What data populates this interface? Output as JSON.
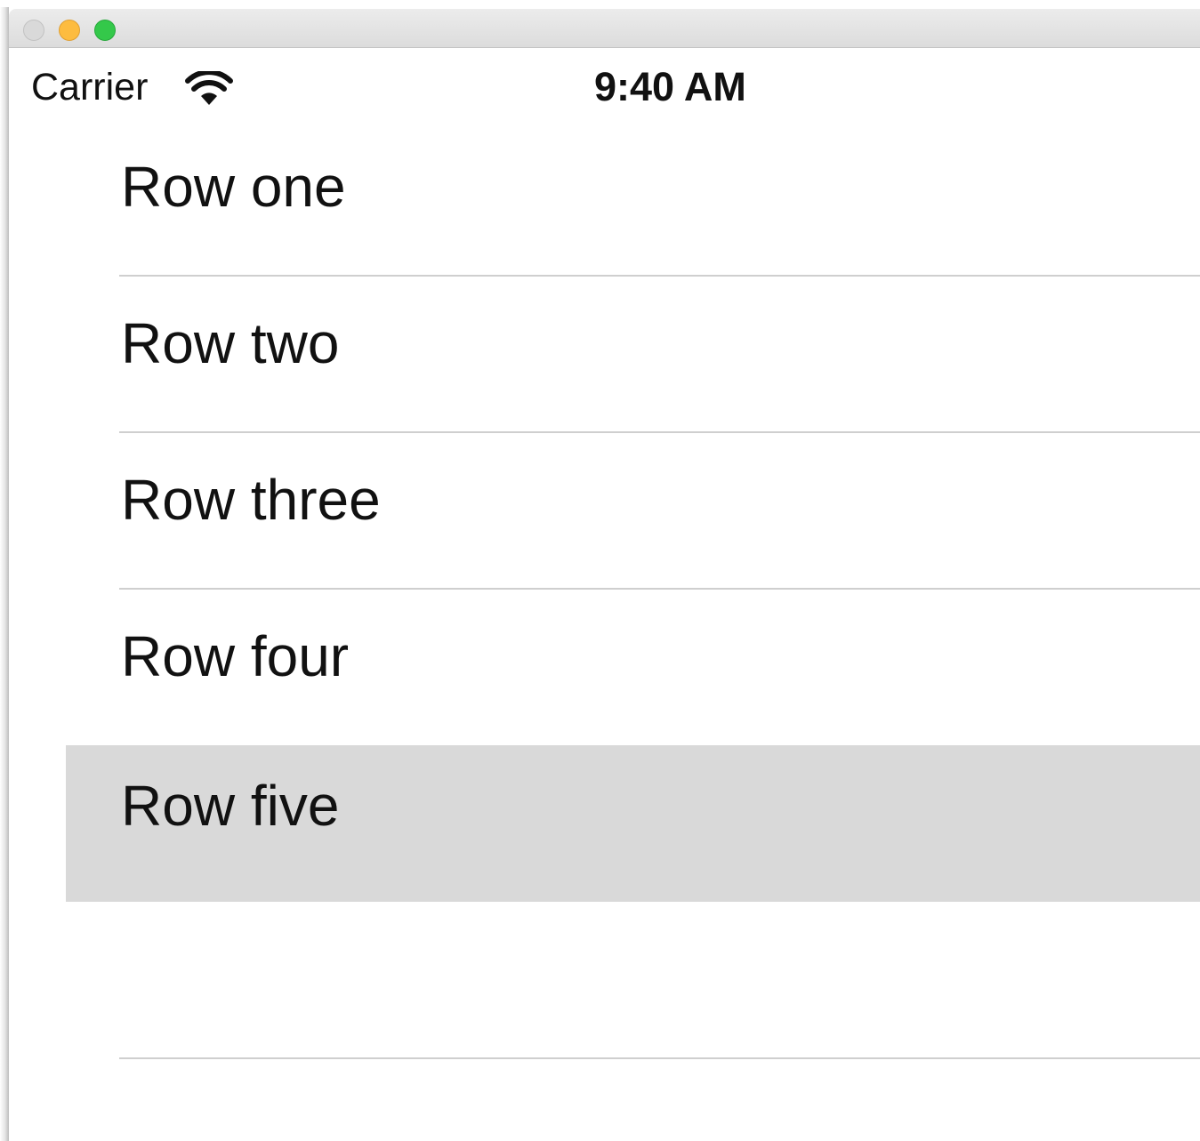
{
  "window": {
    "controls": [
      {
        "name": "close",
        "color": "#d9d9d9"
      },
      {
        "name": "minimize",
        "color": "#fdbc40"
      },
      {
        "name": "zoom",
        "color": "#34c84a"
      }
    ]
  },
  "statusbar": {
    "carrier": "Carrier",
    "wifi_icon": "wifi-icon",
    "time": "9:40 AM"
  },
  "table": {
    "rows": [
      {
        "label": "Row one",
        "selected": false
      },
      {
        "label": "Row two",
        "selected": false
      },
      {
        "label": "Row three",
        "selected": false
      },
      {
        "label": "Row four",
        "selected": false
      },
      {
        "label": "Row five",
        "selected": true
      },
      {
        "label": "",
        "selected": false
      }
    ],
    "selection_color": "#d9d9d9",
    "separator_color": "#cfcfcf"
  }
}
